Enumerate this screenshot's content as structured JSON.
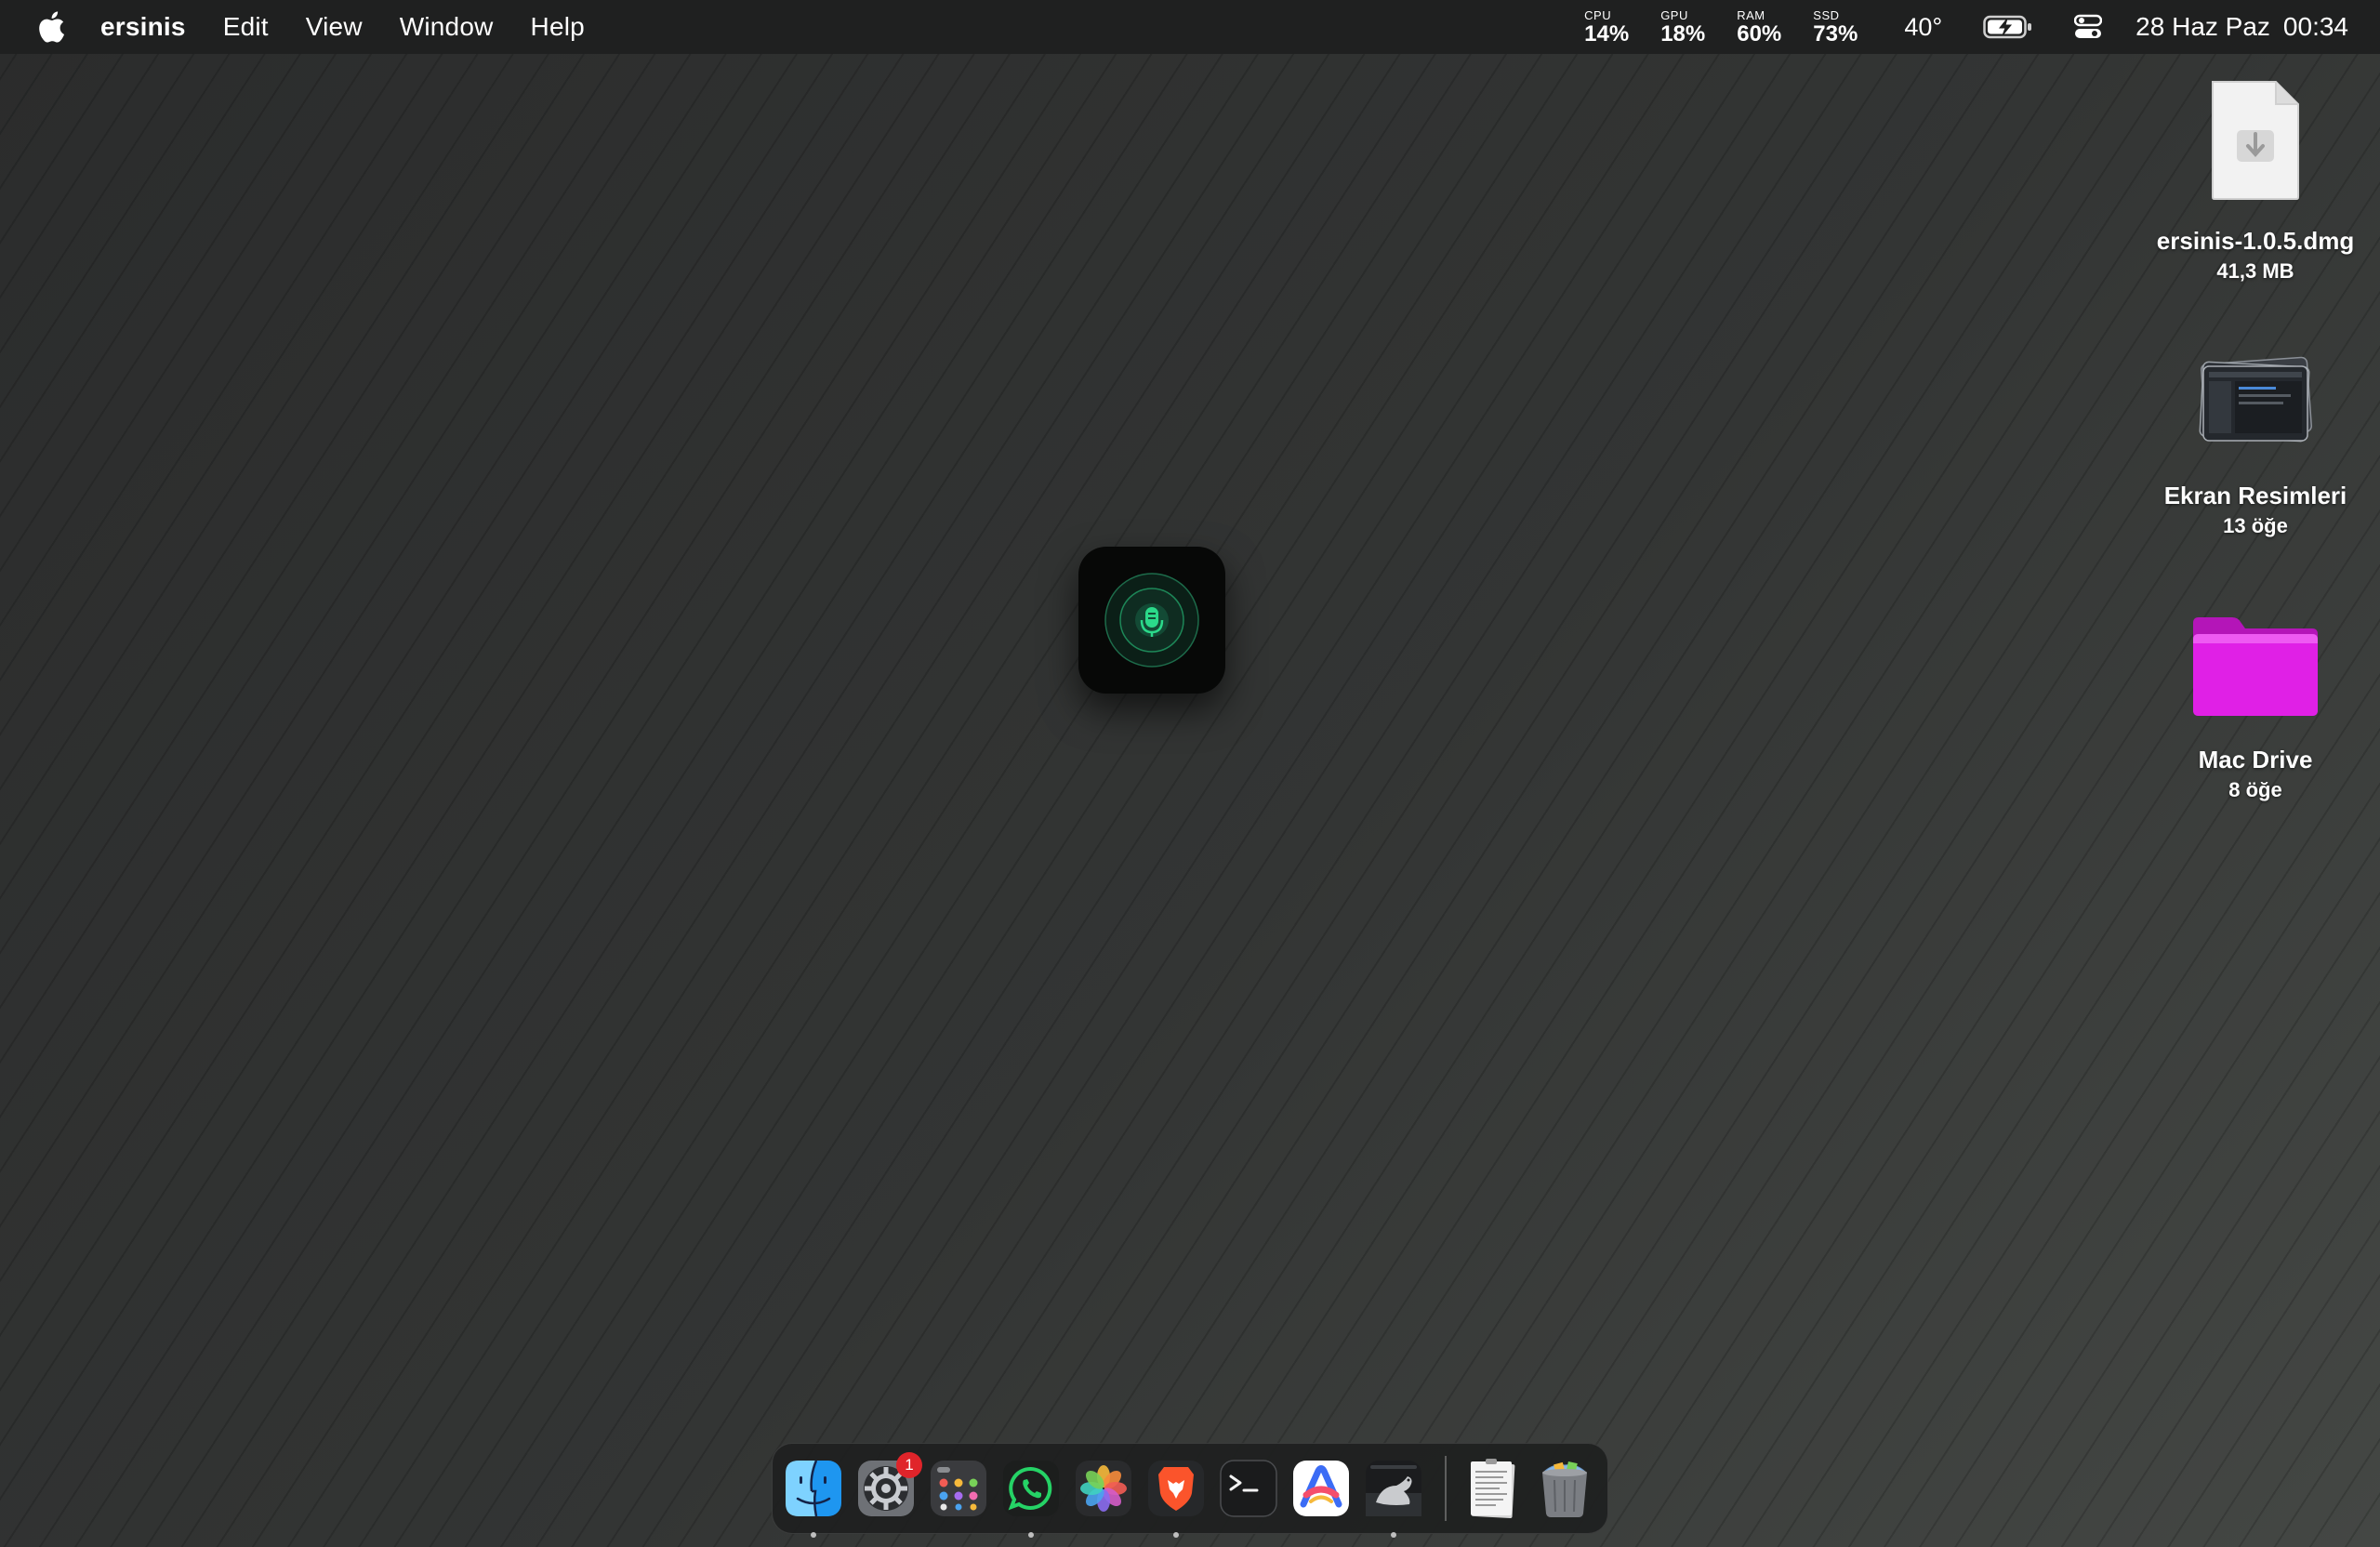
{
  "menubar": {
    "apple_icon": "apple-logo-icon",
    "app_name": "ersinis",
    "items": [
      {
        "label": "Edit"
      },
      {
        "label": "View"
      },
      {
        "label": "Window"
      },
      {
        "label": "Help"
      }
    ],
    "stats": [
      {
        "label": "CPU",
        "value": "14%"
      },
      {
        "label": "GPU",
        "value": "18%"
      },
      {
        "label": "RAM",
        "value": "60%"
      },
      {
        "label": "SSD",
        "value": "73%"
      }
    ],
    "temperature": "40°",
    "battery_icon": "battery-charging-icon",
    "control_center_icon": "control-center-icon",
    "date": "28 Haz Paz",
    "time": "00:34"
  },
  "desktop": {
    "items": [
      {
        "name": "ersinis-1.0.5.dmg",
        "sub": "41,3 MB",
        "icon": "dmg-file-icon"
      },
      {
        "name": "Ekran Resimleri",
        "sub": "13 öğe",
        "icon": "screenshots-stack-icon"
      },
      {
        "name": "Mac Drive",
        "sub": "8 öğe",
        "icon": "folder-icon",
        "color": "#e020e6"
      }
    ]
  },
  "widget": {
    "icon": "microphone-icon",
    "accent": "#2bd98a"
  },
  "dock": {
    "apps": [
      {
        "name": "Finder",
        "icon": "finder-icon",
        "running": true
      },
      {
        "name": "System Settings",
        "icon": "settings-gear-icon",
        "badge": "1",
        "running": false
      },
      {
        "name": "Launchpad",
        "icon": "launchpad-icon",
        "running": false
      },
      {
        "name": "WhatsApp",
        "icon": "whatsapp-icon",
        "running": true
      },
      {
        "name": "Photos",
        "icon": "photos-icon",
        "running": false
      },
      {
        "name": "Brave",
        "icon": "brave-lion-icon",
        "running": true
      },
      {
        "name": "Terminal",
        "icon": "terminal-icon",
        "running": false
      },
      {
        "name": "Arc",
        "icon": "arc-browser-icon",
        "running": false
      },
      {
        "name": "macOS Installer",
        "icon": "sea-lion-icon",
        "running": true
      }
    ],
    "others": [
      {
        "name": "Document",
        "icon": "document-icon"
      },
      {
        "name": "Trash",
        "icon": "trash-full-icon"
      }
    ]
  }
}
